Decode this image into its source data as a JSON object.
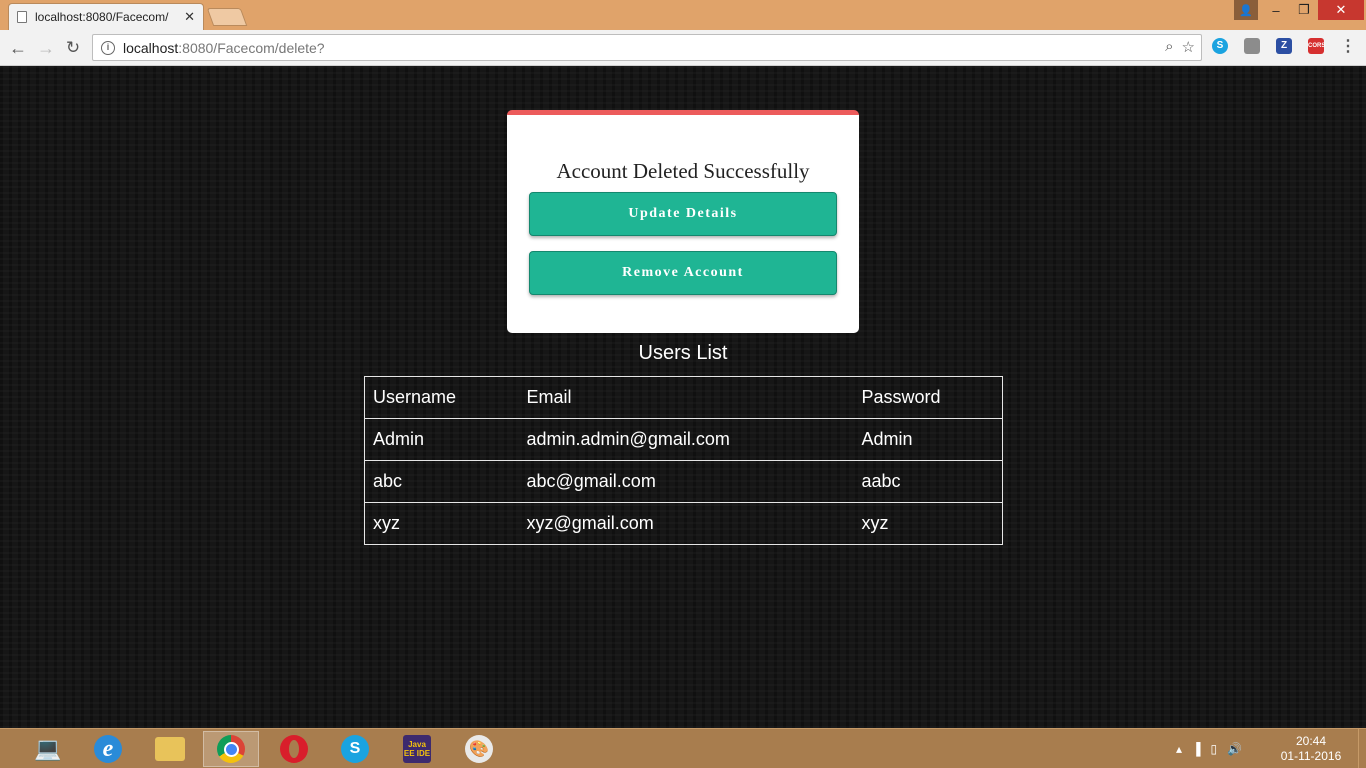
{
  "browser": {
    "tab_title": "localhost:8080/Facecom/",
    "tab_close": "✕",
    "url_host": "localhost",
    "url_rest": ":8080/Facecom/delete?",
    "extensions": [
      "skype-icon",
      "pocket-icon",
      "zotero-icon",
      "cors-icon"
    ],
    "cors_label": "CORS",
    "z_label": "Z"
  },
  "page": {
    "message": "Account Deleted Successfully",
    "update_button": "Update Details",
    "remove_button": "Remove Account",
    "users_title": "Users List",
    "table": {
      "headers": [
        "Username",
        "Email",
        "Password"
      ],
      "rows": [
        [
          "Admin",
          "admin.admin@gmail.com",
          "Admin"
        ],
        [
          "abc",
          "abc@gmail.com",
          "aabc"
        ],
        [
          "xyz",
          "xyz@gmail.com",
          "xyz"
        ]
      ]
    },
    "colors": {
      "button": "#1fb594",
      "card_accent": "#ec5b5b"
    }
  },
  "taskbar": {
    "apps": [
      "laptop-icon",
      "internet-explorer-icon",
      "file-explorer-icon",
      "chrome-icon",
      "opera-icon",
      "skype-icon",
      "java-ee-ide-icon",
      "paint-icon"
    ],
    "java_label": "Java EE IDE",
    "time": "20:44",
    "date": "01-11-2016"
  }
}
